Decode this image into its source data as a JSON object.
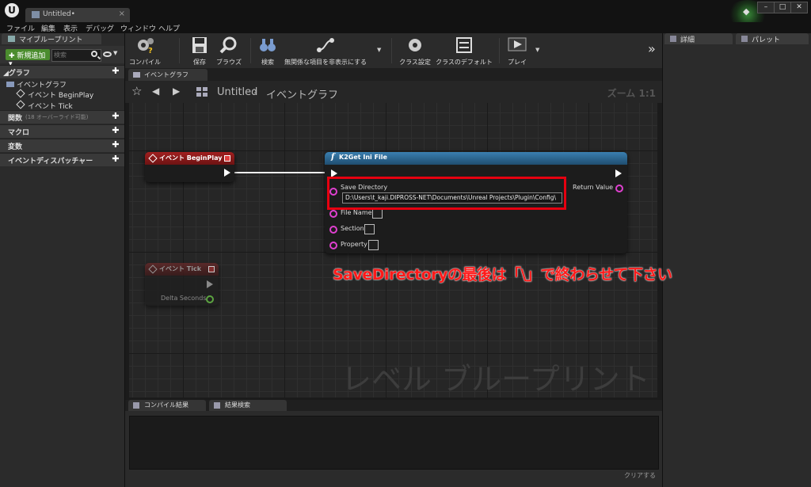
{
  "window": {
    "doc_tab": "Untitled•",
    "controls": {
      "min": "–",
      "max": "□",
      "close": "✕"
    }
  },
  "menu": [
    "ファイル",
    "編集",
    "表示",
    "デバッグ",
    "ウィンドウ",
    "ヘルプ"
  ],
  "left_panel": {
    "tab": "マイブループリント",
    "new_button": "✚ 新規追加 ▾",
    "search_placeholder": "検索",
    "sections": {
      "graph": "◢グラフ",
      "functions": "関数",
      "functions_note": "(18 オーバーライド可能)",
      "macros": "マクロ",
      "variables": "変数",
      "dispatchers": "イベントディスパッチャー"
    },
    "tree": {
      "event_graph": "イベントグラフ",
      "begin_play": "イベント BeginPlay",
      "tick": "イベント Tick"
    },
    "plus": "✚"
  },
  "toolbar": {
    "compile": "コンパイル",
    "save": "保存",
    "browse": "ブラウズ",
    "find": "検索",
    "hide_unrelated": "無関係な項目を非表示にする",
    "class_settings": "クラス設定",
    "class_defaults": "クラスのデフォルト",
    "play": "プレイ",
    "overflow": "»"
  },
  "right_panel": {
    "details": "詳細",
    "palette": "パレット"
  },
  "graph": {
    "tab": "イベントグラフ",
    "breadcrumb_untitled": "Untitled",
    "breadcrumb_sep": "›",
    "breadcrumb_graph": "イベントグラフ",
    "zoom": "ズーム 1:1",
    "watermark": "レベル ブループリント"
  },
  "nodes": {
    "begin_play": {
      "title": "イベント BeginPlay"
    },
    "tick": {
      "title": "イベント Tick",
      "delta": "Delta Seconds"
    },
    "get_ini": {
      "title": "K2Get Ini File",
      "func_icon": "f",
      "save_directory": "Save Directory",
      "save_directory_value": "D:\\Users\\t_kaji.DIPROSS-NET\\Documents\\Unreal Projects\\Plugin\\Config\\",
      "file_name": "File Name",
      "section": "Section",
      "property": "Property",
      "return_value": "Return Value"
    }
  },
  "annotation": "SaveDirectoryの最後は「\\」で終わらせて下さい",
  "bottom": {
    "compile_results": "コンパイル結果",
    "find_results": "結果検索",
    "clear": "クリアする"
  },
  "colors": {
    "event_node_head": "#8c1a1a",
    "function_node_head": "#2b5f86",
    "annotation_red": "#ff1a1a",
    "new_button_green": "#4b8c2e",
    "string_pin": "#e040d0"
  }
}
